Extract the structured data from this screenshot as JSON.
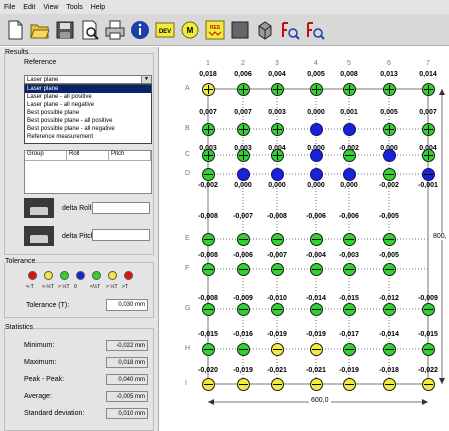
{
  "menu": [
    "File",
    "Edit",
    "View",
    "Tools",
    "Help"
  ],
  "toolbar": {
    "icons": [
      "new-icon",
      "open-icon",
      "save-icon",
      "print-preview-icon",
      "print-icon",
      "info-icon",
      "dev-icon",
      "m-icon",
      "res-icon",
      "grid-view-icon",
      "3d-view-icon",
      "zoom-in-icon",
      "zoom-out-icon"
    ],
    "dev_label": "DEV",
    "m_label": "M",
    "res_label": "RES"
  },
  "results": {
    "title": "Results",
    "reference_label": "Reference",
    "selected": "Laser plane",
    "options": [
      "Laser plane",
      "Laser plane - all positive",
      "Laser plane - all negative",
      "Best possible plane",
      "Best possible plane - all positive",
      "Best possible plane - all negative",
      "Reference measurement"
    ],
    "table_headers": [
      "Group",
      "Roll",
      "Pitch"
    ],
    "delta_roll": "delta Roll:",
    "delta_pitch": "delta Pitch:"
  },
  "tolerance": {
    "title": "Tolerance",
    "legend": [
      "<-T",
      "<-½T",
      "> ½T",
      "0",
      "<½T",
      "> ½T",
      ">T"
    ],
    "legend_colors": [
      "#e01010",
      "#f2ea3c",
      "#2fd42f",
      "#1a22d8",
      "#2fd42f",
      "#f2ea3c",
      "#e01010"
    ],
    "label": "Tolerance (T):",
    "value": "0,030 mm"
  },
  "statistics": {
    "title": "Statistics",
    "rows": [
      {
        "label": "Minimum:",
        "value": "-0,022 mm"
      },
      {
        "label": "Maximum:",
        "value": "0,018 mm"
      },
      {
        "label": "Peak - Peak:",
        "value": "0,040 mm"
      },
      {
        "label": "Average:",
        "value": "-0,005 mm"
      },
      {
        "label": "Standard deviation:",
        "value": "0,010 mm"
      }
    ]
  },
  "grid": {
    "columns": [
      "1",
      "2",
      "3",
      "4",
      "5",
      "6",
      "7"
    ],
    "rows": [
      "A",
      "B",
      "C",
      "D",
      "E",
      "F",
      "G",
      "H",
      "I"
    ],
    "values": [
      [
        "0,018",
        "0,006",
        "0,004",
        "0,005",
        "0,008",
        "0,013",
        "0,014"
      ],
      [
        "0,007",
        "0,007",
        "0,003",
        "0,000",
        "0,001",
        "0,005",
        "0,007"
      ],
      [
        "0,003",
        "0,003",
        "0,004",
        "0,000",
        "-0,002",
        "0,000",
        "0,004"
      ],
      [
        "-0,002",
        "0,000",
        "0,000",
        "0,000",
        "0,000",
        "-0,002",
        "-0,001"
      ],
      [
        "-0,008",
        "-0,007",
        "-0,008",
        "-0,006",
        "-0,006",
        "-0,005",
        ""
      ],
      [
        "-0,008",
        "-0,006",
        "-0,007",
        "-0,004",
        "-0,003",
        "-0,005",
        ""
      ],
      [
        "-0,008",
        "-0,009",
        "-0,010",
        "-0,014",
        "-0,015",
        "-0,012",
        "-0,009"
      ],
      [
        "-0,015",
        "-0,016",
        "-0,019",
        "-0,019",
        "-0,017",
        "-0,014",
        "-0,015"
      ],
      [
        "-0,020",
        "-0,019",
        "-0,021",
        "-0,021",
        "-0,019",
        "-0,018",
        "-0,022"
      ]
    ],
    "colors": [
      [
        "yellow",
        "green",
        "green",
        "green",
        "green",
        "green",
        "green"
      ],
      [
        "green",
        "green",
        "green",
        "blue",
        "blue",
        "green",
        "green"
      ],
      [
        "green",
        "green",
        "green",
        "blue",
        "green",
        "blue",
        "green"
      ],
      [
        "green",
        "blue",
        "blue",
        "blue",
        "blue",
        "green",
        "blue"
      ],
      [
        "green",
        "green",
        "green",
        "green",
        "green",
        "green",
        ""
      ],
      [
        "green",
        "green",
        "green",
        "green",
        "green",
        "green",
        ""
      ],
      [
        "green",
        "green",
        "green",
        "green",
        "green",
        "green",
        "green"
      ],
      [
        "green",
        "green",
        "yellow",
        "yellow",
        "green",
        "green",
        "green"
      ],
      [
        "yellow",
        "yellow",
        "yellow",
        "yellow",
        "yellow",
        "yellow",
        "yellow"
      ]
    ],
    "marks": [
      [
        "plus",
        "plus",
        "plus",
        "plus",
        "plus",
        "plus",
        "plus"
      ],
      [
        "plus",
        "plus",
        "plus",
        "",
        "",
        "plus",
        "plus"
      ],
      [
        "plus",
        "plus",
        "plus",
        "",
        "minus",
        "",
        "plus"
      ],
      [
        "minus",
        "",
        "",
        "",
        "",
        "minus",
        "minus"
      ],
      [
        "minus",
        "minus",
        "minus",
        "minus",
        "minus",
        "minus",
        ""
      ],
      [
        "minus",
        "minus",
        "minus",
        "minus",
        "minus",
        "minus",
        ""
      ],
      [
        "minus",
        "minus",
        "minus",
        "minus",
        "minus",
        "minus",
        "minus"
      ],
      [
        "minus",
        "minus",
        "minus",
        "minus",
        "minus",
        "minus",
        "minus"
      ],
      [
        "minus",
        "minus",
        "minus",
        "minus",
        "minus",
        "minus",
        "minus"
      ]
    ],
    "width_label": "600,0",
    "height_label": "800,"
  }
}
